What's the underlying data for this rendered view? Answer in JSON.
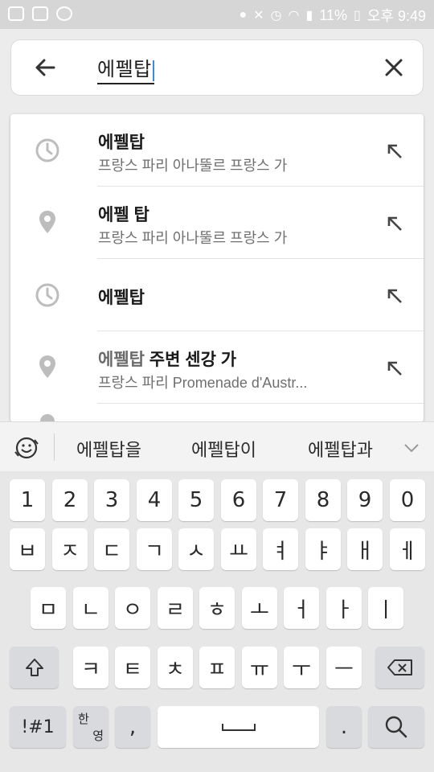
{
  "status_bar": {
    "battery_pct": "11%",
    "time": "오후 9:49",
    "icons": [
      "facebook-icon",
      "image-icon",
      "talk-icon",
      "location-icon",
      "mute-icon",
      "alarm-icon",
      "wifi-icon",
      "signal-icon",
      "battery-icon"
    ]
  },
  "search": {
    "query": "에펠탑",
    "back_icon": "arrow-left-icon",
    "clear_icon": "close-icon"
  },
  "suggestions": [
    {
      "icon": "history-icon",
      "title": "에펠탑",
      "title_dim": "",
      "subtitle": "프랑스 파리 아나뚤르 프랑스 가"
    },
    {
      "icon": "place-icon",
      "title": "에펠 탑",
      "title_dim": "",
      "subtitle": "프랑스 파리 아나뚤르 프랑스 가"
    },
    {
      "icon": "history-icon",
      "title": "에펠탑",
      "title_dim": "",
      "subtitle": ""
    },
    {
      "icon": "place-icon",
      "title": " 주변 센강 가",
      "title_dim": "에펠탑",
      "subtitle": "프랑스 파리 Promenade d'Austr..."
    }
  ],
  "predictions": [
    "에펠탑을",
    "에펠탑이",
    "에펠탑과"
  ],
  "keyboard": {
    "row1": [
      "1",
      "2",
      "3",
      "4",
      "5",
      "6",
      "7",
      "8",
      "9",
      "0"
    ],
    "row2": [
      "ㅂ",
      "ㅈ",
      "ㄷ",
      "ㄱ",
      "ㅅ",
      "ㅛ",
      "ㅕ",
      "ㅑ",
      "ㅐ",
      "ㅔ"
    ],
    "row3": [
      "ㅁ",
      "ㄴ",
      "ㅇ",
      "ㄹ",
      "ㅎ",
      "ㅗ",
      "ㅓ",
      "ㅏ",
      "ㅣ"
    ],
    "row4": [
      "ㅋ",
      "ㅌ",
      "ㅊ",
      "ㅍ",
      "ㅠ",
      "ㅜ",
      "ㅡ"
    ],
    "symbols_key": "!#1",
    "lang_key_top": "한",
    "lang_key_bottom": "영",
    "comma_key": ",",
    "period_key": "."
  },
  "colors": {
    "accent_cursor": "#3b8ae0",
    "status_bar": "#d6d6d6"
  }
}
